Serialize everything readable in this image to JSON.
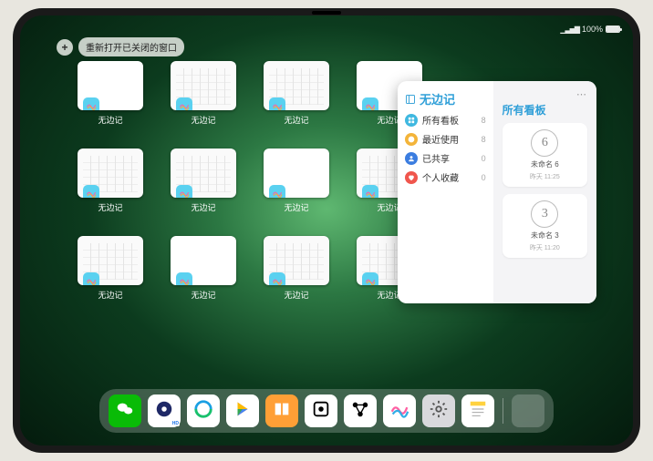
{
  "status": {
    "battery_pct_label": "100%"
  },
  "reopen_pill": {
    "plus": "+",
    "label": "重新打开已关闭的窗口"
  },
  "app_name": "无边记",
  "overview": {
    "items": [
      {
        "label": "无边记",
        "variant": "blank"
      },
      {
        "label": "无边记",
        "variant": "kanban"
      },
      {
        "label": "无边记",
        "variant": "kanban"
      },
      {
        "label": "无边记",
        "variant": "blank"
      },
      {
        "label": "无边记",
        "variant": "kanban"
      },
      {
        "label": "无边记",
        "variant": "kanban"
      },
      {
        "label": "无边记",
        "variant": "blank"
      },
      {
        "label": "无边记",
        "variant": "kanban"
      },
      {
        "label": "无边记",
        "variant": "kanban"
      },
      {
        "label": "无边记",
        "variant": "blank"
      },
      {
        "label": "无边记",
        "variant": "kanban"
      },
      {
        "label": "无边记",
        "variant": "kanban"
      }
    ]
  },
  "panel": {
    "nav_title": "无边记",
    "boards_title": "所有看板",
    "nav": [
      {
        "icon": "grid",
        "color": "#3fb8e0",
        "label": "所有看板",
        "count": "8"
      },
      {
        "icon": "clock",
        "color": "#f3b43a",
        "label": "最近使用",
        "count": "8"
      },
      {
        "icon": "person",
        "color": "#3b7de0",
        "label": "已共享",
        "count": "0"
      },
      {
        "icon": "heart",
        "color": "#f0564d",
        "label": "个人收藏",
        "count": "0"
      }
    ],
    "boards": [
      {
        "glyph": "6",
        "name": "未命名 6",
        "time": "昨天 11:25"
      },
      {
        "glyph": "3",
        "name": "未命名 3",
        "time": "昨天 11:20"
      }
    ]
  },
  "dock": {
    "apps": [
      {
        "name": "wechat",
        "bg": "#09bb07"
      },
      {
        "name": "quark",
        "bg": "#fff"
      },
      {
        "name": "qq-browser",
        "bg": "#fff"
      },
      {
        "name": "play",
        "bg": "#fff"
      },
      {
        "name": "books",
        "bg": "#ff9f36"
      },
      {
        "name": "dice",
        "bg": "#fff"
      },
      {
        "name": "nodes",
        "bg": "#fff"
      },
      {
        "name": "freeform",
        "bg": "#fff"
      },
      {
        "name": "settings",
        "bg": "#d9d9dd"
      },
      {
        "name": "notes",
        "bg": "#fff"
      }
    ],
    "recents": [
      {
        "bg1": "#f7d24a",
        "bg2": "#6fc8f0",
        "bg3": "#3fb77d",
        "bg4": "#2f8be6"
      }
    ]
  }
}
